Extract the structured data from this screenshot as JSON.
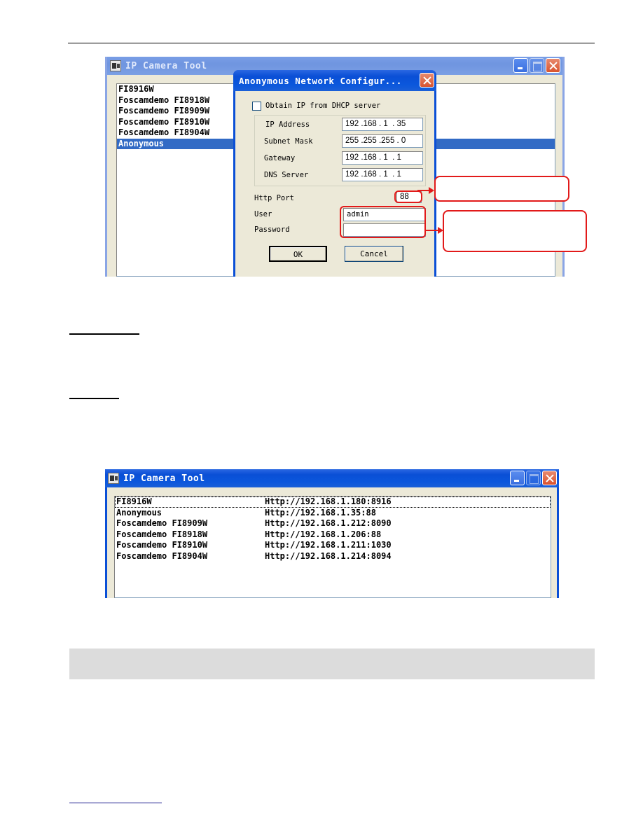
{
  "window1": {
    "title": "IP Camera Tool",
    "devices": [
      {
        "name": "FI8916W",
        "selected": false
      },
      {
        "name": "Foscamdemo FI8918W",
        "selected": false
      },
      {
        "name": "Foscamdemo FI8909W",
        "selected": false
      },
      {
        "name": "Foscamdemo FI8910W",
        "selected": false
      },
      {
        "name": "Foscamdemo FI8904W",
        "selected": false
      },
      {
        "name": "Anonymous",
        "selected": true
      }
    ]
  },
  "dialog": {
    "title": "Anonymous Network Configur...",
    "dhcp_label": "Obtain IP from DHCP server",
    "dhcp_checked": false,
    "fields": {
      "ip_address": {
        "label": "IP Address",
        "value": "192 .168 . 1  . 35"
      },
      "subnet_mask": {
        "label": "Subnet Mask",
        "value": "255 .255 .255 . 0"
      },
      "gateway": {
        "label": "Gateway",
        "value": "192 .168 . 1  . 1"
      },
      "dns_server": {
        "label": "DNS Server",
        "value": "192 .168 . 1  . 1"
      }
    },
    "http_port": {
      "label": "Http Port",
      "value": "88"
    },
    "user": {
      "label": "User",
      "value": "admin"
    },
    "password": {
      "label": "Password",
      "value": ""
    },
    "ok_label": "OK",
    "cancel_label": "Cancel"
  },
  "window2": {
    "title": "IP Camera Tool",
    "devices": [
      {
        "name": "FI8916W",
        "url": "Http://192.168.1.180:8916",
        "focused": true
      },
      {
        "name": "Anonymous",
        "url": "Http://192.168.1.35:88",
        "focused": false
      },
      {
        "name": "Foscamdemo FI8909W",
        "url": "Http://192.168.1.212:8090",
        "focused": false
      },
      {
        "name": "Foscamdemo FI8918W",
        "url": "Http://192.168.1.206:88",
        "focused": false
      },
      {
        "name": "Foscamdemo FI8910W",
        "url": "Http://192.168.1.211:1030",
        "focused": false
      },
      {
        "name": "Foscamdemo FI8904W",
        "url": "Http://192.168.1.214:8094",
        "focused": false
      }
    ]
  },
  "colors": {
    "selection": "#316ac5",
    "annotation": "#e21a1a",
    "titlebar_active": "#0a4fd6",
    "note_bar": "#dcdcdc"
  }
}
